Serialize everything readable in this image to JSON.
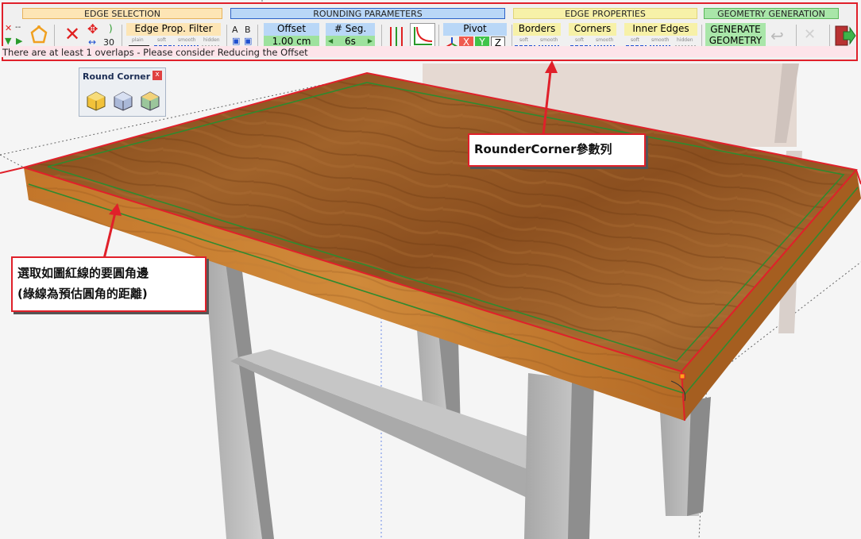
{
  "toolbar": {
    "sections": {
      "edge_selection": "EDGE SELECTION",
      "rounding_parameters": "ROUNDING PARAMETERS",
      "edge_properties": "EDGE PROPERTIES",
      "geometry_generation": "GEOMETRY GENERATION"
    },
    "selection": {
      "count": "30",
      "minus": "--"
    },
    "edge_prop_filter": {
      "label": "Edge Prop. Filter",
      "options": [
        "plain",
        "soft",
        "smooth",
        "hidden"
      ]
    },
    "ab": {
      "a": "A",
      "b": "B"
    },
    "offset": {
      "label": "Offset",
      "value": "1.00 cm"
    },
    "segments": {
      "label": "# Seg.",
      "value": "6s"
    },
    "pivot": {
      "label": "Pivot",
      "x": "X",
      "y": "Y",
      "z": "Z"
    },
    "borders": {
      "label": "Borders",
      "options": [
        "soft",
        "smooth"
      ]
    },
    "corners": {
      "label": "Corners",
      "options": [
        "soft",
        "smooth"
      ]
    },
    "inner_edges": {
      "label": "Inner Edges",
      "options": [
        "soft",
        "smooth",
        "hidden"
      ]
    },
    "generate": {
      "line1": "GENERATE",
      "line2": "GEOMETRY"
    },
    "status": "There are at least 1 overlaps - Please consider Reducing the Offset"
  },
  "palette": {
    "title": "Round Corner",
    "close": "x"
  },
  "annotations": {
    "toolbar_note": "RounderCorner參數列",
    "edge_note_line1": "選取如圖紅線的要圓角邊",
    "edge_note_line2": "(綠線為預估圓角的距離)"
  },
  "colors": {
    "highlight_red": "#e0202a",
    "estimate_green": "#2f8a2f",
    "wood": "#9a5a22"
  }
}
